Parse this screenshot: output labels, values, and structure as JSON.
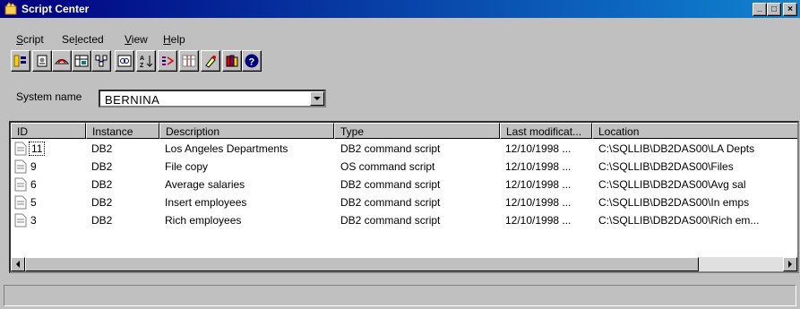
{
  "window": {
    "title": "Script Center",
    "minimize": "_",
    "maximize": "□",
    "close": "×"
  },
  "menu": [
    {
      "label": "Script",
      "mnemonic": "S",
      "rest": "cript"
    },
    {
      "label": "Selected",
      "pre": "Se",
      "mnemonic": "l",
      "rest": "ected"
    },
    {
      "label": "View",
      "mnemonic": "V",
      "rest": "iew"
    },
    {
      "label": "Help",
      "mnemonic": "H",
      "rest": "elp"
    }
  ],
  "toolbar": {
    "icons": [
      "object-tree-icon",
      "new-script-icon",
      "command-center-icon",
      "journal-icon",
      "control-center-icon",
      "replication-icon",
      "sort-icon",
      "filter-icon",
      "customize-columns-icon",
      "information-center-icon",
      "books-icon",
      "help-icon"
    ]
  },
  "system": {
    "label": "System name",
    "value": "BERNINA"
  },
  "table": {
    "columns": [
      "ID",
      "Instance",
      "Description",
      "Type",
      "Last modificat...",
      "Location"
    ],
    "rows": [
      {
        "id": "11",
        "instance": "DB2",
        "description": "Los Angeles Departments",
        "type": "DB2 command script",
        "modified": "12/10/1998 ...",
        "location": "C:\\SQLLIB\\DB2DAS00\\LA Depts"
      },
      {
        "id": "9",
        "instance": "DB2",
        "description": "File copy",
        "type": "OS command script",
        "modified": "12/10/1998 ...",
        "location": "C:\\SQLLIB\\DB2DAS00\\Files"
      },
      {
        "id": "6",
        "instance": "DB2",
        "description": "Average salaries",
        "type": "DB2 command script",
        "modified": "12/10/1998 ...",
        "location": "C:\\SQLLIB\\DB2DAS00\\Avg sal"
      },
      {
        "id": "5",
        "instance": "DB2",
        "description": "Insert employees",
        "type": "DB2 command script",
        "modified": "12/10/1998 ...",
        "location": "C:\\SQLLIB\\DB2DAS00\\In emps"
      },
      {
        "id": "3",
        "instance": "DB2",
        "description": "Rich employees",
        "type": "DB2 command script",
        "modified": "12/10/1998 ...",
        "location": "C:\\SQLLIB\\DB2DAS00\\Rich em..."
      }
    ]
  },
  "colors": {
    "titlebar_start": "#000080",
    "titlebar_end": "#1084d0",
    "face": "#c0c0c0"
  }
}
